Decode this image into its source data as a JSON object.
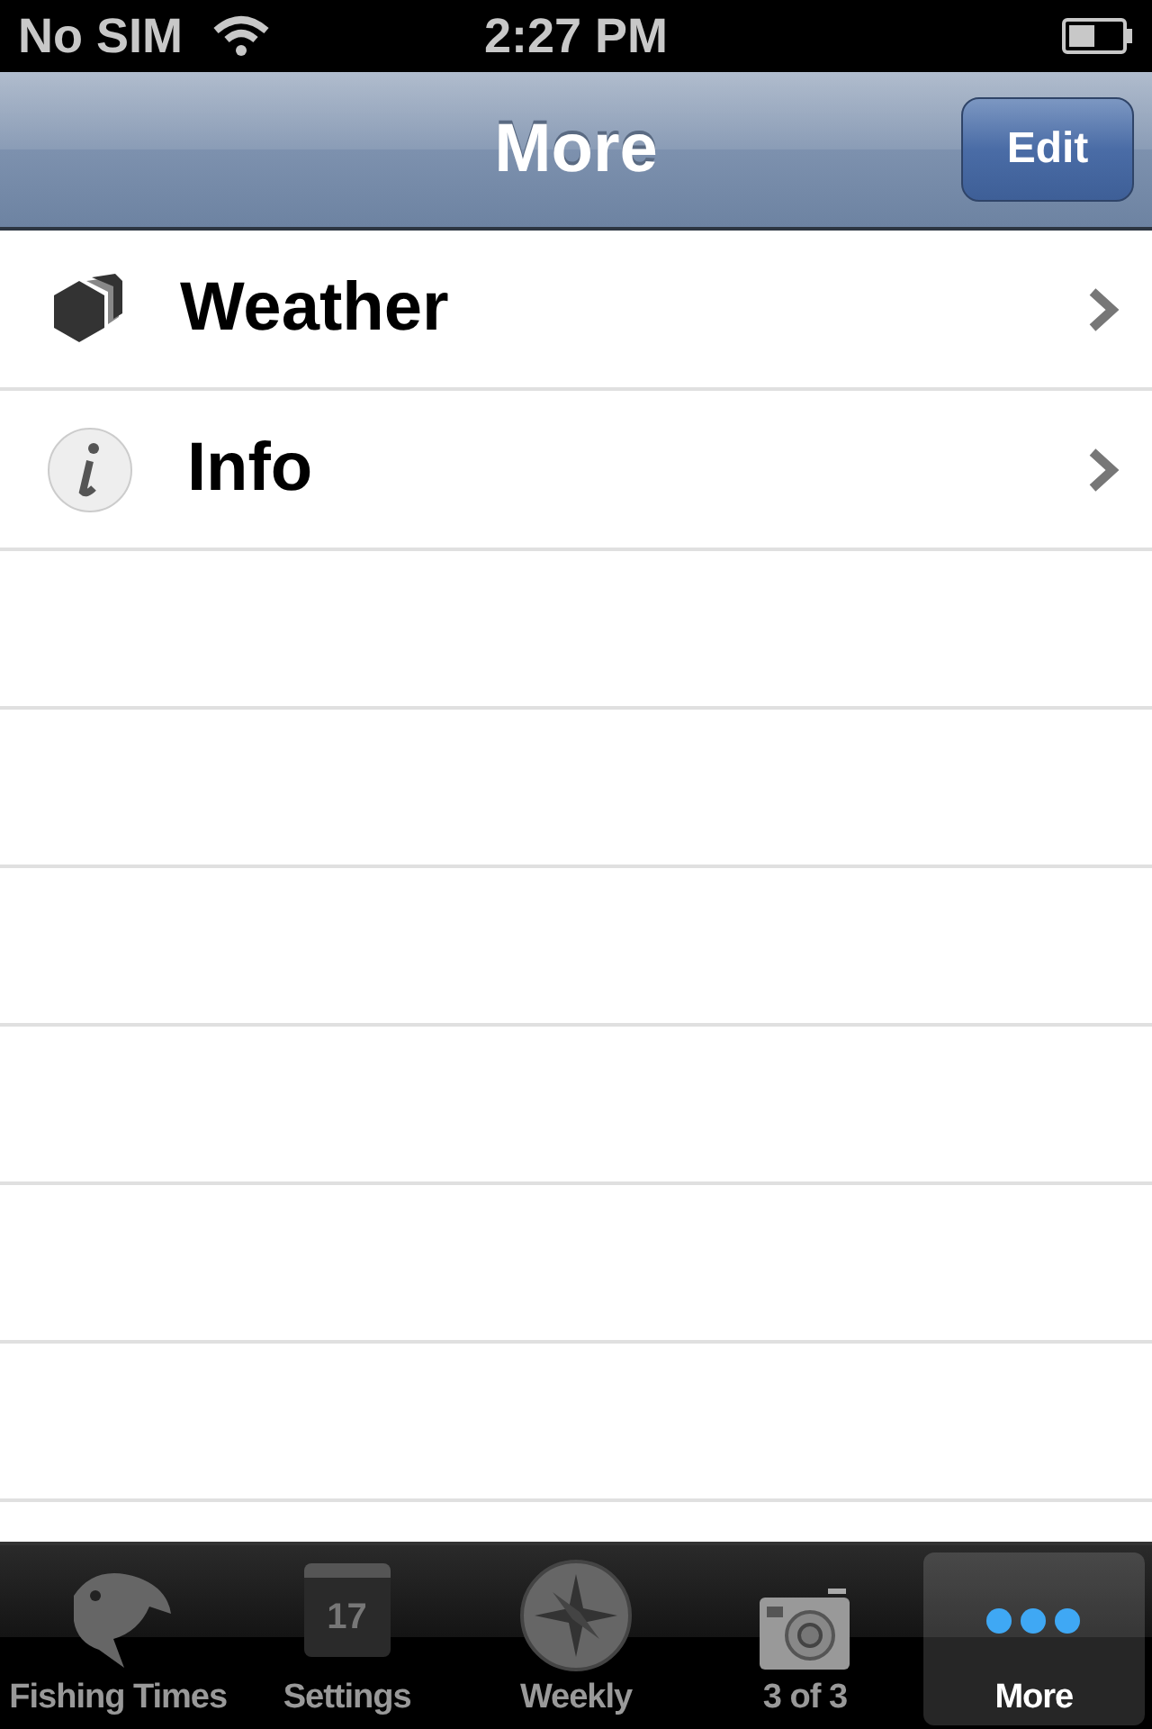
{
  "status_bar": {
    "carrier": "No SIM",
    "time": "2:27 PM"
  },
  "nav_bar": {
    "title": "More",
    "edit_button": "Edit"
  },
  "rows": [
    {
      "label": "Weather",
      "kind": "cube"
    },
    {
      "label": "Info",
      "kind": "info"
    }
  ],
  "tab_bar": [
    {
      "label": "Fishing Times",
      "kind": "fish",
      "selected": false
    },
    {
      "label": "Settings",
      "kind": "calendar",
      "icon_text": "17",
      "selected": false
    },
    {
      "label": "Weekly",
      "kind": "compass",
      "selected": false
    },
    {
      "label": "3 of 3",
      "kind": "camera",
      "selected": false
    },
    {
      "label": "More",
      "kind": "dots",
      "selected": true
    }
  ]
}
